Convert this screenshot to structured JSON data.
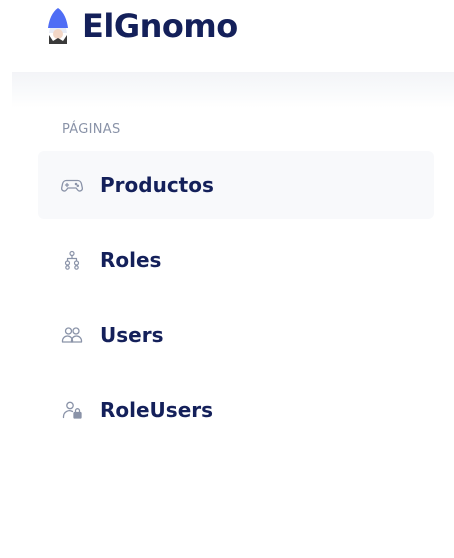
{
  "brand": {
    "name": "ElGnomo",
    "logo_icon": "gnome-logo-icon",
    "logo_color": "#4f6df5"
  },
  "sidebar": {
    "section_title": "PÁGINAS",
    "items": [
      {
        "label": "Productos",
        "icon": "gamepad-icon",
        "active": true
      },
      {
        "label": "Roles",
        "icon": "hierarchy-icon",
        "active": false
      },
      {
        "label": "Users",
        "icon": "users-icon",
        "active": false
      },
      {
        "label": "RoleUsers",
        "icon": "user-lock-icon",
        "active": false
      }
    ]
  },
  "colors": {
    "text_primary": "#14205a",
    "text_muted": "#8a93a8",
    "icon_gray": "#8a93a8",
    "active_bg": "#f8f9fb"
  }
}
